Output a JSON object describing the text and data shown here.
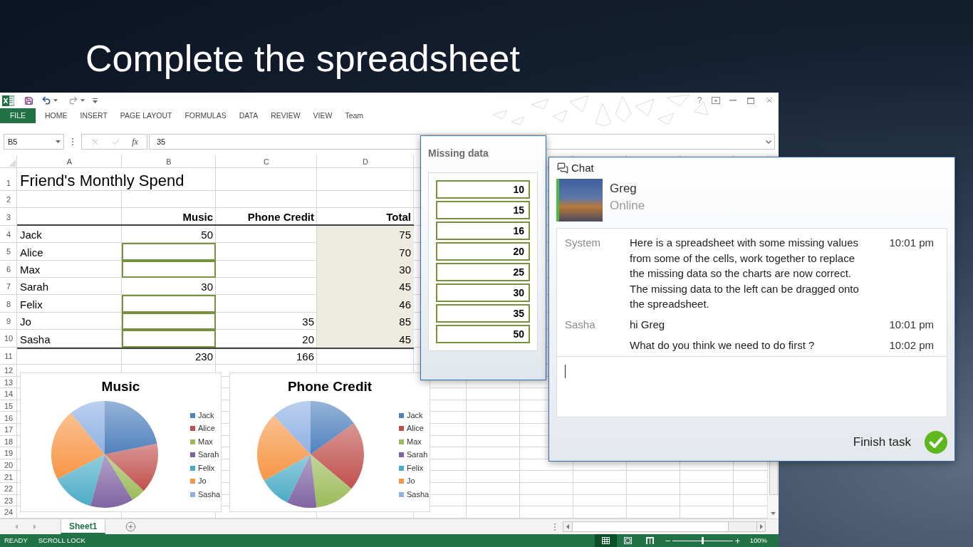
{
  "title": "Complete the spreadsheet",
  "excel": {
    "help_label": "?",
    "ribbon_tabs": [
      {
        "label": "FILE",
        "kind": "file"
      },
      {
        "label": "HOME",
        "kind": "tab"
      },
      {
        "label": "INSERT",
        "kind": "tab"
      },
      {
        "label": "PAGE LAYOUT",
        "kind": "tab"
      },
      {
        "label": "FORMULAS",
        "kind": "tab"
      },
      {
        "label": "DATA",
        "kind": "tab"
      },
      {
        "label": "REVIEW",
        "kind": "tab"
      },
      {
        "label": "VIEW",
        "kind": "tab"
      },
      {
        "label": "Team",
        "kind": "tab"
      }
    ],
    "name_box": {
      "value": "B5"
    },
    "formula_bar": {
      "function_label": "fx",
      "value": "35"
    },
    "columns": [
      "A",
      "B",
      "C",
      "D"
    ],
    "rows": [
      {
        "number": "1",
        "kind": "title",
        "cells": [
          {
            "kind": "title",
            "text": "Friend's Monthly Spend"
          }
        ]
      },
      {
        "number": "2",
        "kind": "blank"
      },
      {
        "number": "3",
        "kind": "header",
        "cells": [
          {
            "kind": "empty"
          },
          {
            "kind": "heading",
            "text": "Music"
          },
          {
            "kind": "heading",
            "text": "Phone Credit"
          },
          {
            "kind": "heading",
            "text": "Total"
          }
        ]
      },
      {
        "number": "4",
        "kind": "data",
        "cells": [
          {
            "kind": "text",
            "text": "Jack"
          },
          {
            "kind": "number",
            "text": "50"
          },
          {
            "kind": "empty"
          },
          {
            "kind": "total",
            "text": "75"
          }
        ]
      },
      {
        "number": "5",
        "kind": "data",
        "cells": [
          {
            "kind": "text",
            "text": "Alice"
          },
          {
            "kind": "slot"
          },
          {
            "kind": "empty"
          },
          {
            "kind": "total",
            "text": "70"
          }
        ]
      },
      {
        "number": "6",
        "kind": "data",
        "cells": [
          {
            "kind": "text",
            "text": "Max"
          },
          {
            "kind": "slot"
          },
          {
            "kind": "empty"
          },
          {
            "kind": "total",
            "text": "30"
          }
        ]
      },
      {
        "number": "7",
        "kind": "data",
        "cells": [
          {
            "kind": "text",
            "text": "Sarah"
          },
          {
            "kind": "number",
            "text": "30"
          },
          {
            "kind": "empty"
          },
          {
            "kind": "total",
            "text": "45"
          }
        ]
      },
      {
        "number": "8",
        "kind": "data",
        "cells": [
          {
            "kind": "text",
            "text": "Felix"
          },
          {
            "kind": "slot"
          },
          {
            "kind": "empty"
          },
          {
            "kind": "total",
            "text": "46"
          }
        ]
      },
      {
        "number": "9",
        "kind": "data",
        "cells": [
          {
            "kind": "text",
            "text": "Jo"
          },
          {
            "kind": "slot"
          },
          {
            "kind": "number",
            "text": "35"
          },
          {
            "kind": "total",
            "text": "85"
          }
        ]
      },
      {
        "number": "10",
        "kind": "data",
        "cells": [
          {
            "kind": "text",
            "text": "Sasha"
          },
          {
            "kind": "slot"
          },
          {
            "kind": "number",
            "text": "20"
          },
          {
            "kind": "total",
            "text": "45"
          }
        ]
      },
      {
        "number": "11",
        "kind": "sum",
        "cells": [
          {
            "kind": "empty"
          },
          {
            "kind": "number",
            "text": "230"
          },
          {
            "kind": "number",
            "text": "166"
          }
        ]
      },
      {
        "number": "12",
        "kind": "blank"
      },
      {
        "number": "13",
        "kind": "blank"
      },
      {
        "number": "14",
        "kind": "blank"
      },
      {
        "number": "15",
        "kind": "blank"
      },
      {
        "number": "16",
        "kind": "blank"
      },
      {
        "number": "17",
        "kind": "blank"
      },
      {
        "number": "18",
        "kind": "blank"
      },
      {
        "number": "19",
        "kind": "blank"
      },
      {
        "number": "20",
        "kind": "blank"
      },
      {
        "number": "21",
        "kind": "blank"
      },
      {
        "number": "22",
        "kind": "blank"
      },
      {
        "number": "23",
        "kind": "blank"
      },
      {
        "number": "24",
        "kind": "blank"
      }
    ],
    "charts": [
      {
        "title": "Music",
        "legend": [
          {
            "label": "Jack",
            "color": "#4f81bd"
          },
          {
            "label": "Alice",
            "color": "#c0504d"
          },
          {
            "label": "Max",
            "color": "#9bbb59"
          },
          {
            "label": "Sarah",
            "color": "#8064a2"
          },
          {
            "label": "Felix",
            "color": "#4bacc6"
          },
          {
            "label": "Jo",
            "color": "#f79646"
          },
          {
            "label": "Sasha",
            "color": "#8eb0e3"
          }
        ]
      },
      {
        "title": "Phone Credit",
        "legend": [
          {
            "label": "Jack",
            "color": "#4f81bd"
          },
          {
            "label": "Alice",
            "color": "#c0504d"
          },
          {
            "label": "Max",
            "color": "#9bbb59"
          },
          {
            "label": "Sarah",
            "color": "#8064a2"
          },
          {
            "label": "Felix",
            "color": "#4bacc6"
          },
          {
            "label": "Jo",
            "color": "#f79646"
          },
          {
            "label": "Sasha",
            "color": "#8eb0e3"
          }
        ]
      }
    ],
    "sheet_tabs": [
      {
        "label": "Sheet1",
        "selected": true
      }
    ],
    "status_bar": {
      "items": [
        "READY",
        "SCROLL LOCK"
      ],
      "views": [
        {
          "kind": "normal",
          "selected": true
        },
        {
          "kind": "page-layout",
          "selected": false
        },
        {
          "kind": "page-break",
          "selected": false
        }
      ],
      "zoom": {
        "level": 0.5,
        "reading": "100%"
      }
    }
  },
  "missing_data": {
    "title": "Missing data",
    "values": [
      "10",
      "15",
      "16",
      "20",
      "25",
      "30",
      "35",
      "50"
    ]
  },
  "chat": {
    "title": "Chat",
    "contact": {
      "name": "Greg",
      "status": "Online",
      "online": true
    },
    "messages": [
      {
        "sender": "System",
        "text": "Here is a spreadsheet with some missing values from some of the cells, work together to replace the missing data so the charts are now correct. The missing data to the left can be dragged onto the spreadsheet.",
        "time": "10:01 pm"
      },
      {
        "sender": "Sasha",
        "text": "hi Greg",
        "time": "10:01 pm"
      },
      {
        "text": "What do you think we need to do first ?",
        "time": "10:02 pm"
      }
    ],
    "finish_button": "Finish task"
  }
}
